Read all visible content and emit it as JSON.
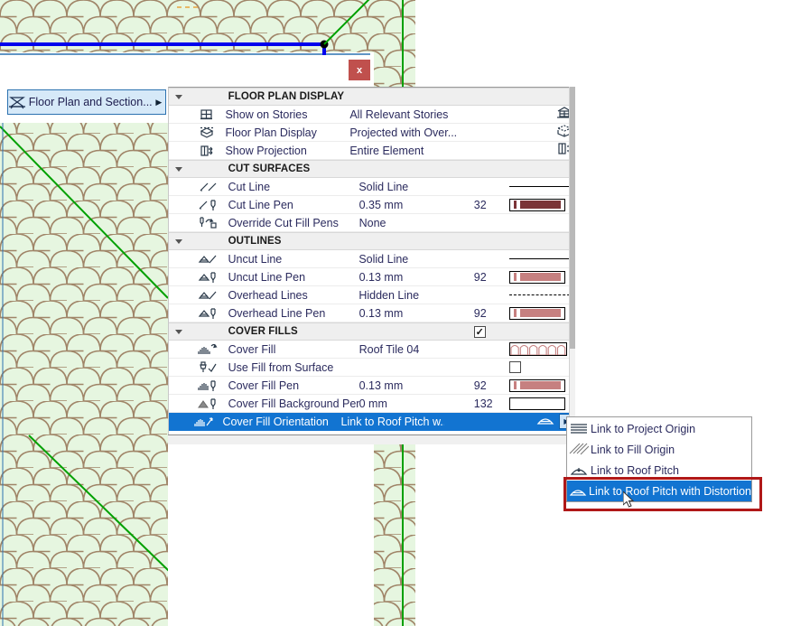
{
  "window": {
    "close_label": "x",
    "tab": {
      "label": "Floor Plan and Section...",
      "icon": "floor-plan-section-icon",
      "arrow": "▶"
    }
  },
  "colors": {
    "selection_blue": "#1274d1",
    "highlight_red": "#b01818",
    "pen32": "#7b3437",
    "pen92": "#c68080",
    "pen132": "#ffffff",
    "tile_fill": "#e6f6e0",
    "tile_line": "#a08568",
    "contour_blue": "#0000ee",
    "contour_green": "#00a000"
  },
  "panel": {
    "scrollbar": "vertical-scrollbar",
    "sections": [
      {
        "title": "FLOOR PLAN DISPLAY",
        "twisty": "collapse-triangle",
        "rows": [
          {
            "icon": "show-on-stories-icon",
            "name": "Show on Stories",
            "value": "All Relevant Stories",
            "num": "",
            "right_icon": "stories-icon"
          },
          {
            "icon": "floor-plan-display-icon",
            "name": "Floor Plan Display",
            "value": "Projected with Over...",
            "num": "",
            "right_icon": "projected-icon"
          },
          {
            "icon": "show-projection-icon",
            "name": "Show Projection",
            "value": "Entire Element",
            "num": "",
            "right_icon": "entire-element-icon"
          }
        ]
      },
      {
        "title": "CUT SURFACES",
        "twisty": "collapse-triangle",
        "rows": [
          {
            "icon": "cut-line-icon",
            "name": "Cut Line",
            "value": "Solid Line",
            "num": "",
            "preview": "solid-line"
          },
          {
            "icon": "cut-line-pen-icon",
            "name": "Cut Line Pen",
            "value": "0.35 mm",
            "num": "32",
            "swatch": "#7b3437"
          },
          {
            "icon": "override-cut-fill-pens-icon",
            "name": "Override Cut Fill Pens",
            "value": "None",
            "num": ""
          }
        ]
      },
      {
        "title": "OUTLINES",
        "twisty": "collapse-triangle",
        "rows": [
          {
            "icon": "uncut-line-icon",
            "name": "Uncut Line",
            "value": "Solid Line",
            "num": "",
            "preview": "solid-line"
          },
          {
            "icon": "uncut-line-pen-icon",
            "name": "Uncut Line Pen",
            "value": "0.13 mm",
            "num": "92",
            "swatch": "#c68080"
          },
          {
            "icon": "overhead-lines-icon",
            "name": "Overhead Lines",
            "value": "Hidden Line",
            "num": "",
            "preview": "dashed-line"
          },
          {
            "icon": "overhead-line-pen-icon",
            "name": "Overhead Line Pen",
            "value": "0.13 mm",
            "num": "92",
            "swatch": "#c68080"
          }
        ]
      },
      {
        "title": "COVER FILLS",
        "twisty": "collapse-triangle",
        "header_checkbox": true,
        "header_checkbox_mark": "✓",
        "rows": [
          {
            "icon": "cover-fill-icon",
            "name": "Cover Fill",
            "value": "Roof Tile 04",
            "num": "",
            "pattern": "roof-tile-04-swatch"
          },
          {
            "icon": "use-fill-from-surface-icon",
            "name": "Use Fill from Surface",
            "value": "",
            "num": "",
            "checkbox": false
          },
          {
            "icon": "cover-fill-pen-icon",
            "name": "Cover Fill Pen",
            "value": "0.13 mm",
            "num": "92",
            "swatch": "#c68080"
          },
          {
            "icon": "cover-fill-background-pen-icon",
            "name": "Cover Fill Background Pen",
            "value": "0 mm",
            "num": "132",
            "swatch": "#ffffff"
          },
          {
            "icon": "cover-fill-orientation-icon",
            "name": "Cover Fill Orientation",
            "value": "Link to Roof Pitch w...",
            "num": "",
            "selected": true,
            "right_icon": "roof-pitch-distortion-icon",
            "popup_arrow": "▶"
          }
        ]
      }
    ]
  },
  "submenu": {
    "name": "cover-fill-orientation-menu",
    "items": [
      {
        "icon": "link-project-origin-icon",
        "label": "Link to Project Origin",
        "selected": false
      },
      {
        "icon": "link-fill-origin-icon",
        "label": "Link to Fill Origin",
        "selected": false
      },
      {
        "icon": "link-roof-pitch-icon",
        "label": "Link to Roof Pitch",
        "selected": false
      },
      {
        "icon": "link-roof-pitch-distortion-icon",
        "label": "Link to Roof Pitch with Distortion",
        "selected": true
      }
    ]
  }
}
